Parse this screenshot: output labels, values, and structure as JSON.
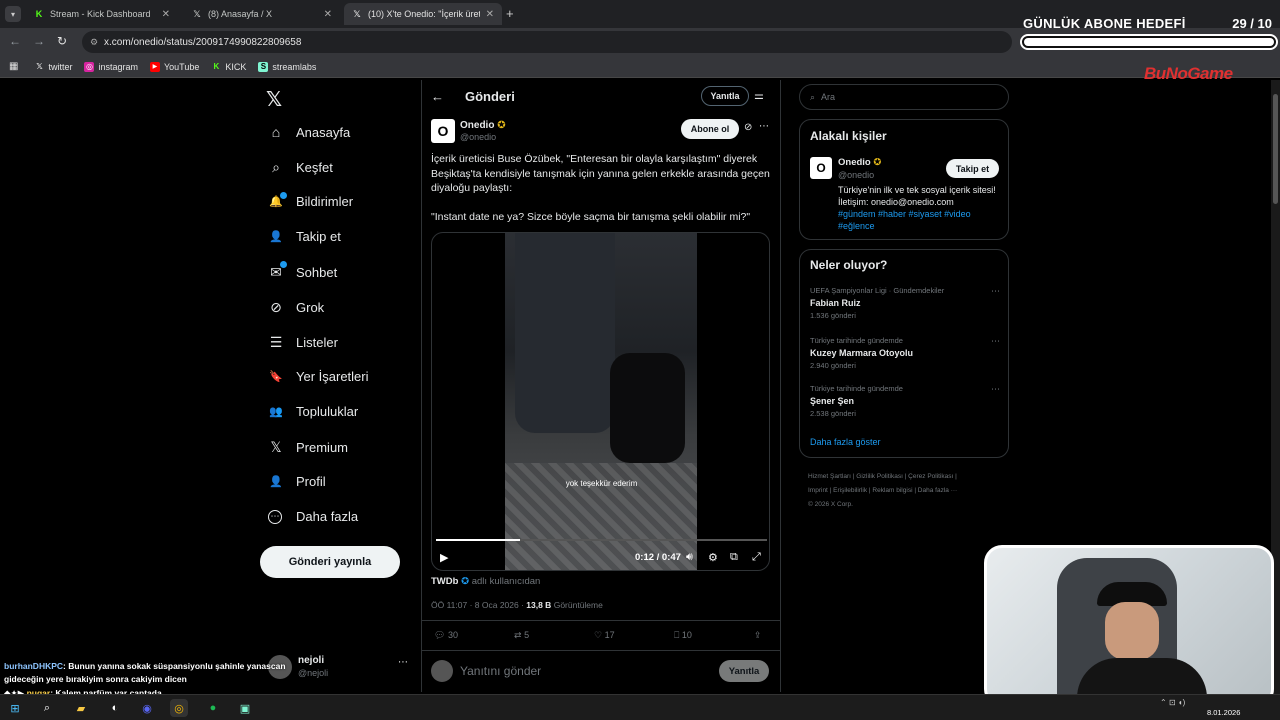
{
  "browser": {
    "tabs": [
      {
        "label": "Stream - Kick Dashboard",
        "icon": "K"
      },
      {
        "label": "(8) Anasayfa / X",
        "icon": "𝕏"
      },
      {
        "label": "(10) X'te Onedio: \"İçerik üreticisi",
        "icon": "𝕏"
      }
    ],
    "url": "x.com/onedio/status/2009174990822809658",
    "bookmarks": [
      {
        "label": "twitter",
        "icon": "𝕏"
      },
      {
        "label": "instagram",
        "icon": "◎"
      },
      {
        "label": "YouTube",
        "icon": "▶"
      },
      {
        "label": "KICK",
        "icon": "K"
      },
      {
        "label": "streamlabs",
        "icon": "S"
      }
    ]
  },
  "overlay": {
    "goal_title": "GÜNLÜK ABONE HEDEFİ",
    "goal_count": "29  / 10",
    "goal_progress": 1.0,
    "brand": "BuNoGame"
  },
  "sidebar": {
    "items": [
      {
        "label": "Anasayfa",
        "icon": "⌂"
      },
      {
        "label": "Keşfet",
        "icon": "⌕"
      },
      {
        "label": "Bildirimler",
        "icon": "🔔"
      },
      {
        "label": "Takip et",
        "icon": "👤"
      },
      {
        "label": "Sohbet",
        "icon": "✉"
      },
      {
        "label": "Grok",
        "icon": "⊘"
      },
      {
        "label": "Listeler",
        "icon": "☰"
      },
      {
        "label": "Yer İşaretleri",
        "icon": "🔖"
      },
      {
        "label": "Topluluklar",
        "icon": "👥"
      },
      {
        "label": "Premium",
        "icon": "𝕏"
      },
      {
        "label": "Profil",
        "icon": "👤"
      },
      {
        "label": "Daha fazla",
        "icon": "⋯"
      }
    ],
    "post_button": "Gönderi yayınla",
    "account": {
      "name": "nejoli",
      "handle": "@nejoli"
    }
  },
  "main": {
    "header_title": "Gönderi",
    "reply_btn": "Yanıtla",
    "author": {
      "name": "Onedio",
      "handle": "@onedio"
    },
    "follow_btn": "Abone ol",
    "text1": "İçerik üreticisi Buse Özübek, \"Enteresan bir olayla karşılaştım\" diyerek Beşiktaş'ta kendisiyle tanışmak için yanına gelen erkekle arasında geçen diyaloğu paylaştı:",
    "text2": "\"Instant date ne ya? Sizce böyle saçma bir tanışma şekli olabilir mi?\"",
    "video": {
      "subtitle": "yok teşekkür ederim",
      "time": "0:12 / 0:47",
      "progress": 0.255
    },
    "source_user": "TWDb",
    "source_suffix": "adlı kullanıcıdan",
    "meta": "ÖÖ 11:07 · 8 Oca 2026 · ",
    "views": "13,8 B",
    "views_label": "Görüntüleme",
    "stats": {
      "replies": "30",
      "reposts": "5",
      "likes": "17",
      "bookmarks": "10"
    },
    "reply_placeholder": "Yanıtını gönder",
    "reply_submit": "Yanıtla"
  },
  "right": {
    "search_placeholder": "Ara",
    "relevant_title": "Alakalı kişiler",
    "person": {
      "name": "Onedio",
      "handle": "@onedio",
      "follow": "Takip et",
      "bio": "Türkiye'nin ilk ve tek sosyal içerik sitesi! İletişim: onedio@onedio.com",
      "tags": "#gündem #haber #siyaset #video #eğlence"
    },
    "trends_title": "Neler oluyor?",
    "trends": [
      {
        "context": "UEFA Şampiyonlar Ligi · Gündemdekiler",
        "name": "Fabian Ruiz",
        "count": "1.536 gönderi"
      },
      {
        "context": "Türkiye tarihinde gündemde",
        "name": "Kuzey Marmara Otoyolu",
        "count": "2.940 gönderi"
      },
      {
        "context": "Türkiye tarihinde gündemde",
        "name": "Şener Şen",
        "count": "2.538 gönderi"
      }
    ],
    "show_more": "Daha fazla göster",
    "footer_line1": "Hizmet Şartları  |  Gizlilik Politikası  |  Çerez Politikası  |",
    "footer_line2": "Imprint  |  Erişilebilirlik  |  Reklam bilgisi  |  Daha fazla ···",
    "footer_line3": "© 2026 X Corp."
  },
  "chat": [
    {
      "user": "burhanDHKPC",
      "msg": ": Bunun yanına sokak süspansiyonlu şahinle yanascan"
    },
    {
      "user": "",
      "msg": "gideceğin yere bırakiyim sonra cakiyim dicen"
    },
    {
      "user": "pugar",
      "msg": ": Kalem parfüm var cantada"
    }
  ],
  "taskbar": {
    "date": "8.01.2026"
  },
  "colors": {
    "accent": "#1d9bf0",
    "kick": "#53fc18",
    "verified_gold": "#e2b719"
  }
}
